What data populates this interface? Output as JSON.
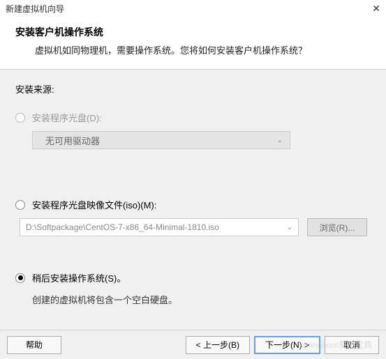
{
  "titlebar": {
    "title": "新建虚拟机向导"
  },
  "header": {
    "title": "安装客户机操作系统",
    "subtitle": "虚拟机如同物理机，需要操作系统。您将如何安装客户机操作系统？"
  },
  "section_label": "安装来源:",
  "options": {
    "disc": {
      "label": "安装程序光盘(D):",
      "dropdown_text": "无可用驱动器"
    },
    "iso": {
      "label": "安装程序光盘映像文件(iso)(M):",
      "path": "D:\\Softpackage\\CentOS-7-x86_64-Minimal-1810.iso",
      "browse": "浏览(R)..."
    },
    "later": {
      "label": "稍后安装操作系统(S)。",
      "note": "创建的虚拟机将包含一个空白硬盘。"
    }
  },
  "footer": {
    "help": "帮助",
    "back": "< 上一步(B)",
    "next": "下一步(N) >",
    "cancel": "取消"
  },
  "watermark": "springboot葵花宝典"
}
